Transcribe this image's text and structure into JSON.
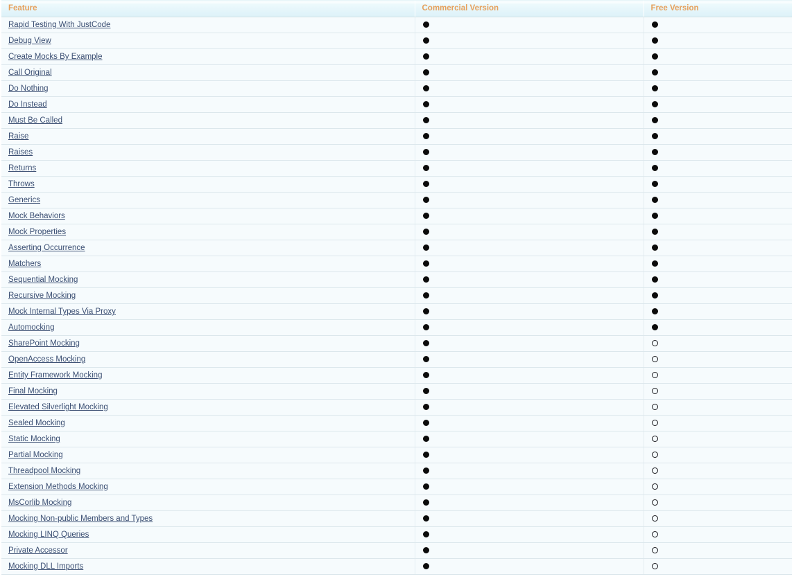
{
  "table": {
    "columns": [
      {
        "key": "feature",
        "label": "Feature"
      },
      {
        "key": "commercial",
        "label": "Commercial Version"
      },
      {
        "key": "free",
        "label": "Free Version"
      }
    ],
    "marks": {
      "filled": "●",
      "hollow": "○"
    },
    "colors": {
      "header_text": "#e5a05c",
      "header_background": "#e2f4fa",
      "row_background": "#f6fbfd",
      "row_border": "#dce7ec",
      "link_text": "#3b4f73",
      "mark_filled": "#0b0b0b",
      "mark_hollow_border": "#17171c"
    },
    "rows": [
      {
        "feature": "Rapid Testing With JustCode",
        "commercial": "filled",
        "free": "filled"
      },
      {
        "feature": "Debug View",
        "commercial": "filled",
        "free": "filled"
      },
      {
        "feature": "Create Mocks By Example",
        "commercial": "filled",
        "free": "filled"
      },
      {
        "feature": "Call Original",
        "commercial": "filled",
        "free": "filled"
      },
      {
        "feature": "Do Nothing",
        "commercial": "filled",
        "free": "filled"
      },
      {
        "feature": "Do Instead",
        "commercial": "filled",
        "free": "filled"
      },
      {
        "feature": "Must Be Called",
        "commercial": "filled",
        "free": "filled"
      },
      {
        "feature": "Raise",
        "commercial": "filled",
        "free": "filled"
      },
      {
        "feature": "Raises",
        "commercial": "filled",
        "free": "filled"
      },
      {
        "feature": "Returns",
        "commercial": "filled",
        "free": "filled"
      },
      {
        "feature": "Throws",
        "commercial": "filled",
        "free": "filled"
      },
      {
        "feature": "Generics",
        "commercial": "filled",
        "free": "filled"
      },
      {
        "feature": "Mock Behaviors",
        "commercial": "filled",
        "free": "filled"
      },
      {
        "feature": "Mock Properties",
        "commercial": "filled",
        "free": "filled"
      },
      {
        "feature": "Asserting Occurrence",
        "commercial": "filled",
        "free": "filled"
      },
      {
        "feature": "Matchers",
        "commercial": "filled",
        "free": "filled"
      },
      {
        "feature": "Sequential Mocking",
        "commercial": "filled",
        "free": "filled"
      },
      {
        "feature": "Recursive Mocking",
        "commercial": "filled",
        "free": "filled"
      },
      {
        "feature": "Mock Internal Types Via Proxy",
        "commercial": "filled",
        "free": "filled"
      },
      {
        "feature": "Automocking",
        "commercial": "filled",
        "free": "filled"
      },
      {
        "feature": "SharePoint Mocking",
        "commercial": "filled",
        "free": "hollow"
      },
      {
        "feature": "OpenAccess Mocking",
        "commercial": "filled",
        "free": "hollow"
      },
      {
        "feature": "Entity Framework Mocking",
        "commercial": "filled",
        "free": "hollow"
      },
      {
        "feature": "Final Mocking",
        "commercial": "filled",
        "free": "hollow"
      },
      {
        "feature": "Elevated Silverlight Mocking",
        "commercial": "filled",
        "free": "hollow"
      },
      {
        "feature": "Sealed Mocking",
        "commercial": "filled",
        "free": "hollow"
      },
      {
        "feature": "Static Mocking",
        "commercial": "filled",
        "free": "hollow"
      },
      {
        "feature": "Partial Mocking",
        "commercial": "filled",
        "free": "hollow"
      },
      {
        "feature": "Threadpool Mocking",
        "commercial": "filled",
        "free": "hollow"
      },
      {
        "feature": "Extension Methods Mocking",
        "commercial": "filled",
        "free": "hollow"
      },
      {
        "feature": "MsCorlib Mocking",
        "commercial": "filled",
        "free": "hollow"
      },
      {
        "feature": "Mocking Non-public Members and Types",
        "commercial": "filled",
        "free": "hollow"
      },
      {
        "feature": "Mocking LINQ Queries",
        "commercial": "filled",
        "free": "hollow"
      },
      {
        "feature": "Private Accessor",
        "commercial": "filled",
        "free": "hollow"
      },
      {
        "feature": "Mocking DLL Imports",
        "commercial": "filled",
        "free": "hollow"
      }
    ]
  }
}
